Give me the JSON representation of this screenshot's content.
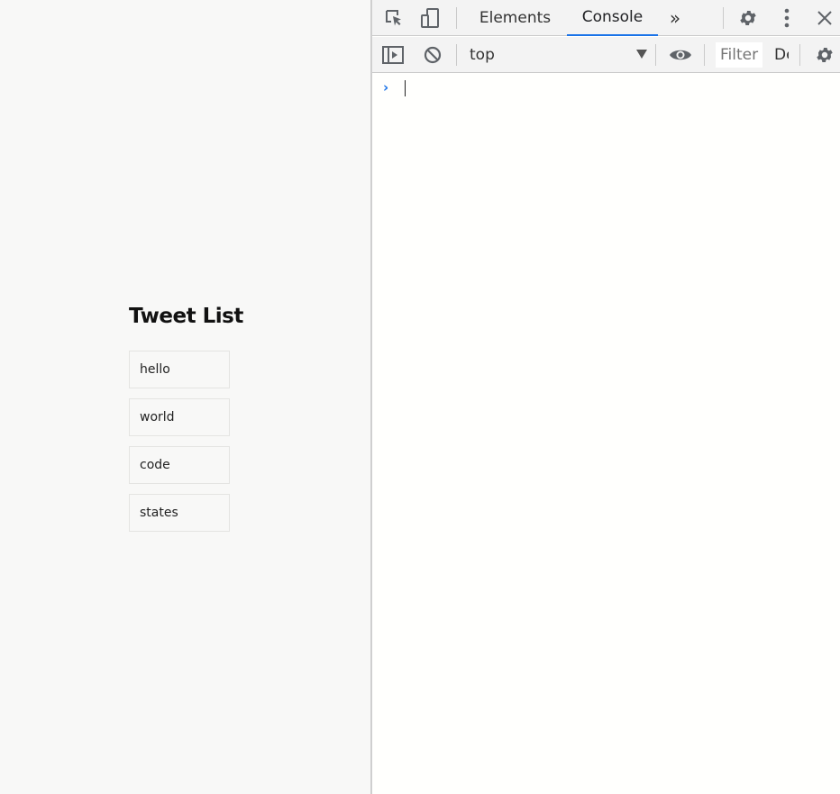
{
  "page": {
    "title": "Tweet List",
    "tweets": [
      "hello",
      "world",
      "code",
      "states"
    ]
  },
  "devtools": {
    "tabs": {
      "elements": "Elements",
      "console": "Console",
      "more": "»"
    },
    "toolbar": {
      "context": "top",
      "filter_placeholder": "Filter",
      "levels_label": "Default levels"
    },
    "console": {
      "prompt_symbol": "›",
      "input_value": ""
    },
    "icons": {
      "inspect": "inspect-element-icon",
      "device": "device-toolbar-icon",
      "settings": "gear-icon",
      "menu": "kebab-menu-icon",
      "close": "close-icon",
      "sidebar": "sidebar-toggle-icon",
      "clear": "clear-console-icon",
      "eye": "live-expression-eye-icon",
      "console_settings": "console-settings-gear-icon"
    },
    "colors": {
      "accent": "#1a73e8",
      "icon": "#5f6368"
    }
  }
}
